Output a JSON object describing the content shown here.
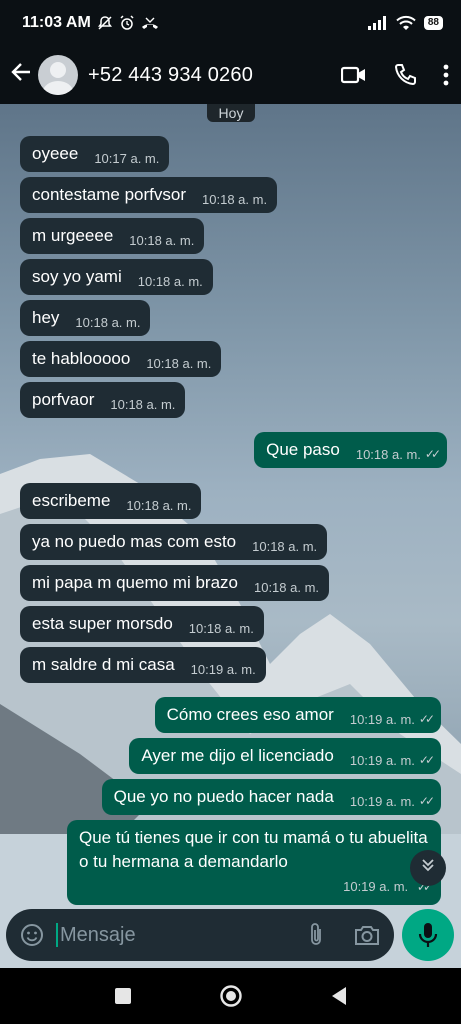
{
  "status_bar": {
    "time": "11:03 AM",
    "battery": "88"
  },
  "header": {
    "back_icon": "arrow-left-icon",
    "contact_name": "+52 443 934 0260"
  },
  "chat": {
    "date_chip": "Hoy",
    "messages": [
      {
        "dir": "in",
        "text": "oyeee",
        "time": "10:17 a. m."
      },
      {
        "dir": "in",
        "text": "contestame porfvsor",
        "time": "10:18 a. m."
      },
      {
        "dir": "in",
        "text": "m urgeeee",
        "time": "10:18 a. m."
      },
      {
        "dir": "in",
        "text": "soy yo yami",
        "time": "10:18 a. m."
      },
      {
        "dir": "in",
        "text": "hey",
        "time": "10:18 a. m."
      },
      {
        "dir": "in",
        "text": "te hablooooo",
        "time": "10:18 a. m."
      },
      {
        "dir": "in",
        "text": "porfvaor",
        "time": "10:18 a. m."
      },
      {
        "dir": "out",
        "text": "Que paso",
        "time": "10:18 a. m."
      },
      {
        "dir": "in",
        "text": "escribeme",
        "time": "10:18 a. m."
      },
      {
        "dir": "in",
        "text": "ya no puedo mas com esto",
        "time": "10:18 a. m."
      },
      {
        "dir": "in",
        "text": "mi papa m quemo mi brazo",
        "time": "10:18 a. m."
      },
      {
        "dir": "in",
        "text": "esta super morsdo",
        "time": "10:18 a. m."
      },
      {
        "dir": "in",
        "text": "m saldre d mi casa",
        "time": "10:19 a. m."
      },
      {
        "dir": "out",
        "text": "Cómo crees eso amor",
        "time": "10:19 a. m."
      },
      {
        "dir": "out",
        "text": "Ayer me dijo el licenciado",
        "time": "10:19 a. m."
      },
      {
        "dir": "out",
        "text": "Que yo no puedo hacer nada",
        "time": "10:19 a. m."
      },
      {
        "dir": "out",
        "text": "Que tú tienes que ir con tu mamá o tu abuelita o tu hermana a demandarlo",
        "time": "10:19 a. m."
      }
    ]
  },
  "composer": {
    "placeholder": "Mensaje"
  },
  "colors": {
    "incoming": "#1f2c34",
    "outgoing": "#005c4b",
    "accent": "#00a884"
  }
}
